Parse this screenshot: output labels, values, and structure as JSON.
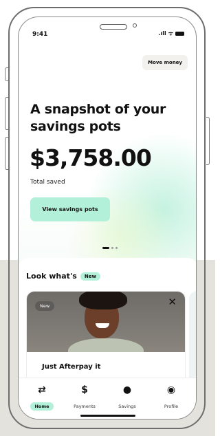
{
  "status": {
    "time": "9:41",
    "signal": ".ıll",
    "wifi": "ᯤ"
  },
  "header": {
    "move_money_label": "Move money"
  },
  "hero": {
    "headline": "A snapshot of your savings pots",
    "amount": "$3,758.00",
    "amount_label": "Total saved",
    "cta_label": "View savings pots"
  },
  "section": {
    "title": "Look what's",
    "badge": "New"
  },
  "promo": {
    "badge": "New",
    "close_icon": "close-icon",
    "title": "Just Afterpay it"
  },
  "tabs": [
    {
      "label": "Home",
      "icon": "afterpay-arrows-icon",
      "glyph": "⇄",
      "active": true
    },
    {
      "label": "Payments",
      "icon": "dollar-circle-icon",
      "glyph": "$",
      "active": false
    },
    {
      "label": "Savings",
      "icon": "piggy-bank-icon",
      "glyph": "●",
      "active": false
    },
    {
      "label": "Profile",
      "icon": "profile-icon",
      "glyph": "◉",
      "active": false
    }
  ],
  "colors": {
    "accent": "#b3f0da",
    "background_band": "#e4e2dc"
  }
}
